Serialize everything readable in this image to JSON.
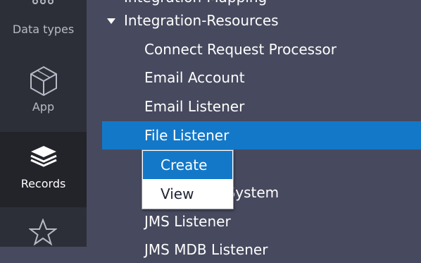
{
  "rail": {
    "data_types_label": "Data types",
    "app_label": "App",
    "records_label": "Records"
  },
  "tree": {
    "partial_top_label": "Integration-Mapping",
    "group_label": "Integration-Resources",
    "items": [
      "Connect Request Processor",
      "Email Account",
      "Email Listener",
      "File Listener",
      "",
      "Integration System",
      "JMS Listener",
      "JMS MDB Listener"
    ]
  },
  "context_menu": {
    "items": [
      "Create",
      "View"
    ]
  },
  "colors": {
    "rail_bg": "#2d2f38",
    "rail_active_bg": "#232429",
    "panel_bg": "#474a5e",
    "selected_bg": "#1478c8"
  }
}
